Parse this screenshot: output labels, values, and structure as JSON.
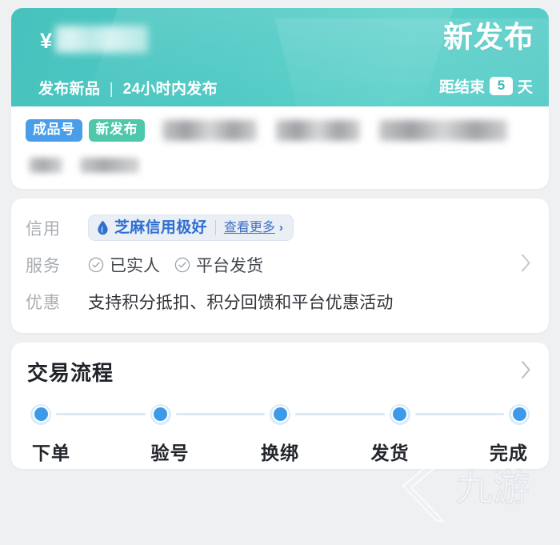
{
  "banner": {
    "currency_symbol": "¥",
    "price_masked": true,
    "subtitle_primary": "发布新品",
    "subtitle_separator": "|",
    "subtitle_secondary": "24小时内发布",
    "title": "新发布",
    "countdown_prefix": "距结束",
    "countdown_days": "5",
    "countdown_suffix": "天",
    "background_color": "#4ec9c4"
  },
  "product": {
    "tags": [
      {
        "label": "成品号",
        "color": "#4a9de8"
      },
      {
        "label": "新发布",
        "color": "#4ec7ab"
      }
    ],
    "title_masked": true,
    "subtitle_masked": true
  },
  "info": {
    "credit": {
      "label": "信用",
      "icon": "sesame-drop-icon",
      "badge_text": "芝麻信用极好",
      "more_label": "查看更多",
      "more_chevron": "›",
      "accent_color": "#2f6fd0"
    },
    "service": {
      "label": "服务",
      "items": [
        {
          "icon": "check-circle-icon",
          "label": "已实人"
        },
        {
          "icon": "check-circle-icon",
          "label": "平台发货"
        }
      ]
    },
    "promo": {
      "label": "优惠",
      "text": "支持积分抵扣、积分回馈和平台优惠活动"
    }
  },
  "flow": {
    "title": "交易流程",
    "chevron": "›",
    "active_color": "#3d9ae8",
    "steps": [
      {
        "label": "下单"
      },
      {
        "label": "验号"
      },
      {
        "label": "换绑"
      },
      {
        "label": "发货"
      },
      {
        "label": "完成"
      }
    ]
  },
  "watermark": {
    "text": "九游"
  }
}
